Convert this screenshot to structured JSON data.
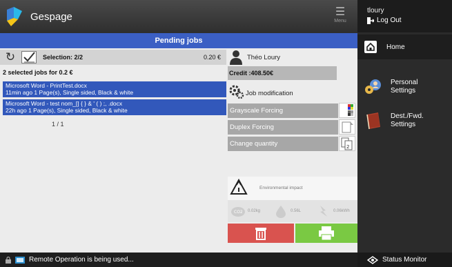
{
  "app": {
    "title": "Gespage",
    "menu_label": "Menu"
  },
  "user_panel": {
    "username": "tloury",
    "logout_label": "Log Out"
  },
  "sidebar": {
    "items": [
      {
        "label": "Home",
        "icon": "home-icon"
      },
      {
        "label": "Personal\nSettings",
        "icon": "personal-settings-icon"
      },
      {
        "label": "Dest./Fwd.\nSettings",
        "icon": "address-book-icon"
      }
    ],
    "status_monitor": "Status Monitor"
  },
  "main": {
    "title": "Pending jobs",
    "selection_label": "Selection: 2/2",
    "selection_amount": "0.20 €",
    "summary": "2 selected jobs for 0.2 €",
    "jobs": [
      {
        "name": "Microsoft Word - PrintTest.docx",
        "details": "11min ago  1 Page(s), Single sided, Black & white"
      },
      {
        "name": "Microsoft Word - test nom_[] { } &  ' ( ) ;, .docx",
        "details": "22h ago  1 Page(s), Single sided, Black & white"
      }
    ],
    "pager": "1 / 1",
    "user_name": "Théo Loury",
    "credit": "Credit :408.50€",
    "job_modification": "Job modification",
    "modifications": [
      "Grayscale Forcing",
      "Duplex Forcing",
      "Change quantity"
    ],
    "environmental_label": "Environmental impact",
    "env": {
      "co2": "0.02kg",
      "water": "0.56L",
      "energy": "0.06kWh"
    }
  },
  "statusbar": {
    "message": "Remote Operation is being used..."
  },
  "colors": {
    "accent": "#3b5fc4",
    "job_selected": "#3258bb",
    "delete": "#d9534f",
    "print": "#7ac943"
  }
}
